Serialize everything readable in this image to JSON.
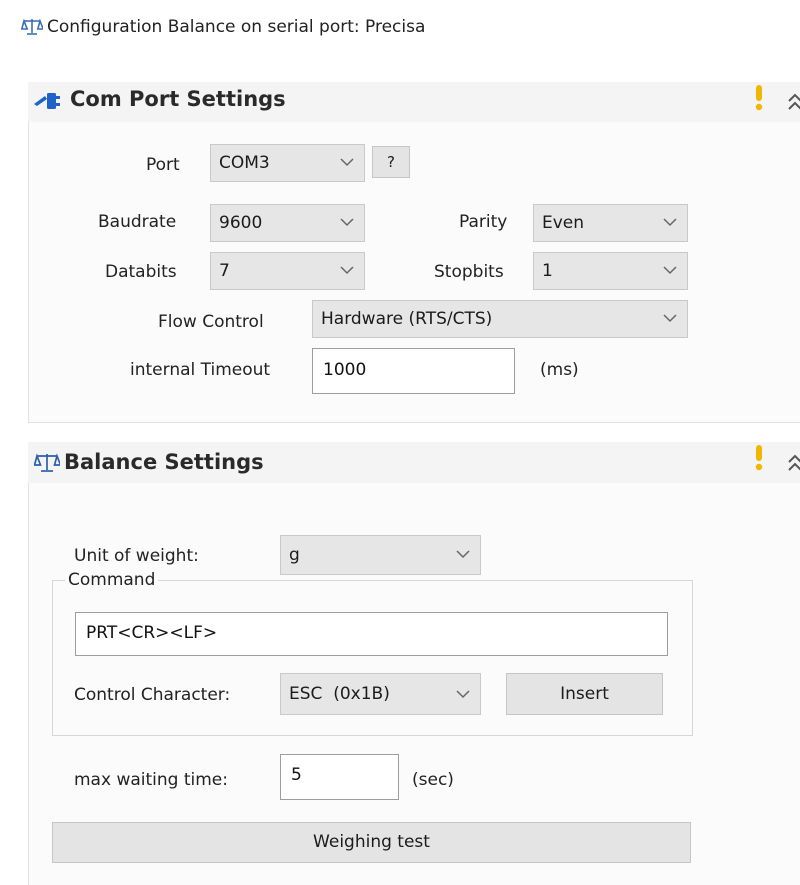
{
  "window": {
    "title": "Configuration Balance on serial port: Precisa",
    "title_icon": "balance-scale-icon"
  },
  "com_port": {
    "title": "Com Port Settings",
    "icon": "serial-port-icon",
    "port_label": "Port",
    "port_value": "COM3",
    "help_label": "?",
    "baudrate_label": "Baudrate",
    "baudrate_value": "9600",
    "parity_label": "Parity",
    "parity_value": "Even",
    "databits_label": "Databits",
    "databits_value": "7",
    "stopbits_label": "Stopbits",
    "stopbits_value": "1",
    "flow_label": "Flow Control",
    "flow_value": "Hardware (RTS/CTS)",
    "timeout_label": "internal Timeout",
    "timeout_value": "1000",
    "timeout_unit": "(ms)"
  },
  "balance": {
    "title": "Balance Settings",
    "icon": "balance-scale-icon",
    "unit_label": "Unit of weight:",
    "unit_value": "g",
    "command_legend": "Command",
    "command_value": "PRT<CR><LF>",
    "control_char_label": "Control Character:",
    "control_char_value": "ESC  (0x1B)",
    "insert_label": "Insert",
    "max_wait_label": "max waiting time:",
    "max_wait_value": "5",
    "max_wait_unit": "(sec)",
    "weighing_test_label": "Weighing test"
  },
  "colors": {
    "warning": "#f2b600",
    "accent_blue": "#1f63c6"
  }
}
